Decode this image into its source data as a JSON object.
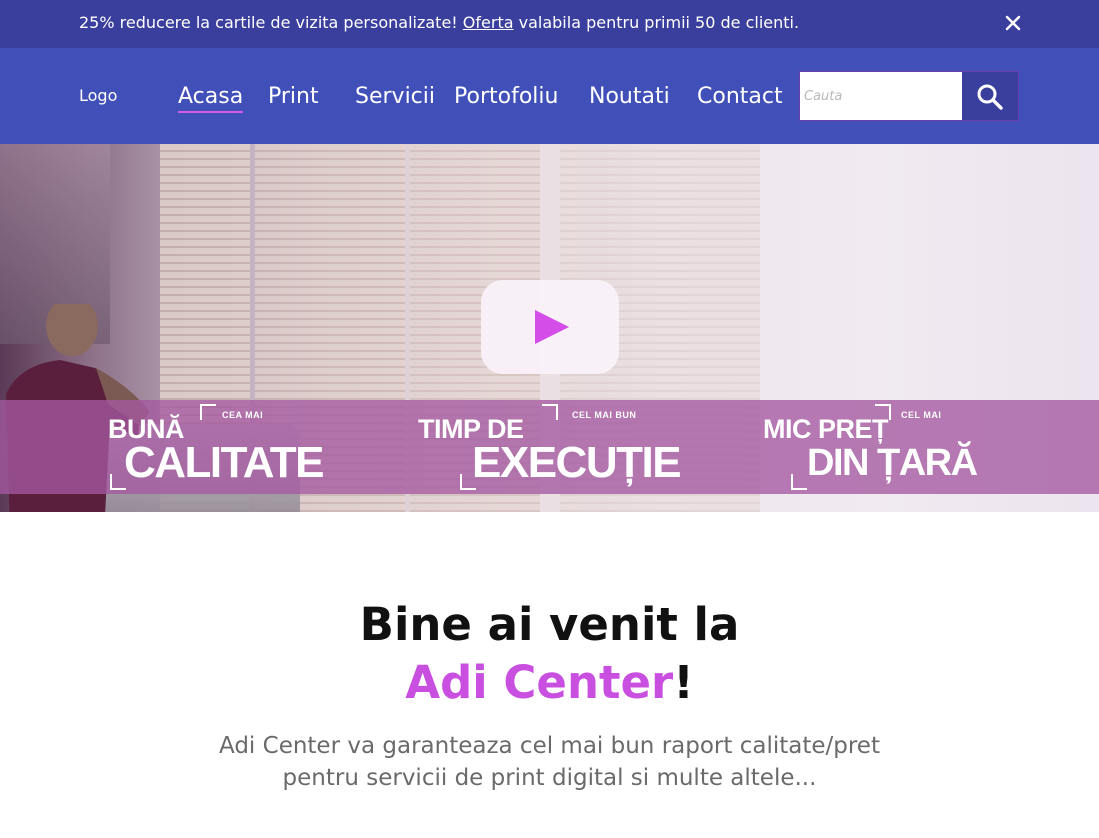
{
  "promo": {
    "text_before": "25% reducere la cartile de vizita personalizate! ",
    "link": "Oferta",
    "text_after": " valabila pentru primii 50 de clienti.",
    "close_icon": "close-icon"
  },
  "header": {
    "logo": "Logo",
    "nav": [
      {
        "label": "Acasa",
        "active": true
      },
      {
        "label": "Print"
      },
      {
        "label": "Servicii"
      },
      {
        "label": "Portofoliu"
      },
      {
        "label": "Noutati"
      },
      {
        "label": "Contact"
      }
    ],
    "search": {
      "placeholder": "Cauta",
      "icon": "search-icon"
    }
  },
  "hero": {
    "play_icon": "play-icon",
    "labels": [
      {
        "small": "CEA MAI",
        "line1": "BUNĂ",
        "line2": "CALITATE"
      },
      {
        "small": "CEL MAI BUN",
        "line1": "TIMP DE",
        "line2": "EXECUȚIE"
      },
      {
        "small": "CEL MAI",
        "line1": "MIC PREȚ",
        "line2": "DIN ȚARĂ"
      }
    ]
  },
  "welcome": {
    "title_line1": "Bine ai venit la",
    "brand": "Adi Center",
    "exclamation": "!",
    "description": "Adi Center va garanteaza cel mai bun raport calitate/pret pentru servicii de print digital si multe altele..."
  },
  "colors": {
    "promo_bg": "#3a3f9e",
    "header_bg": "#4150b8",
    "accent": "#c94fe0"
  }
}
